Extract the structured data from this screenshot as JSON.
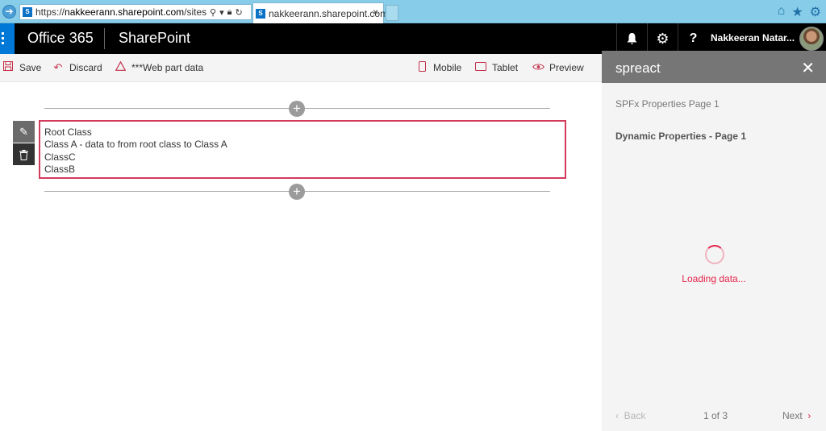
{
  "browser": {
    "url_prefix": "https://",
    "url_host": "nakkeerann.sharepoint.com",
    "url_path": "/sites/spfx/Sha",
    "favicon_text": "S",
    "tab_title": "nakkeerann.sharepoint.com",
    "tab_close": "×",
    "icons": [
      "back-icon",
      "search-icon",
      "lock-icon",
      "refresh-icon",
      "home-icon",
      "star-icon",
      "gear-icon"
    ]
  },
  "suitebar": {
    "brand": "Office 365",
    "app": "SharePoint",
    "user_name": "Nakkeeran Natar...",
    "icons": [
      "bell-icon",
      "gear-icon",
      "help-icon"
    ],
    "help_glyph": "?"
  },
  "commandbar": {
    "save": "Save",
    "discard": "Discard",
    "webpart_data": "***Web part data",
    "mobile": "Mobile",
    "tablet": "Tablet",
    "preview": "Preview"
  },
  "webpart": {
    "lines": [
      "Root Class",
      "Class A - data to from root class to Class A",
      "ClassC",
      "ClassB"
    ]
  },
  "pane": {
    "title": "spreact",
    "page_label_1": "SPFx Properties Page 1",
    "page_label_2": "Dynamic Properties - Page 1",
    "loading": "Loading data...",
    "back": "Back",
    "pager": "1 of 3",
    "next": "Next"
  },
  "colors": {
    "accent": "#e4264c",
    "suitebar": "#000000",
    "waffle": "#0078d7",
    "pane_header": "#767676",
    "browser_chrome": "#87cde9"
  }
}
